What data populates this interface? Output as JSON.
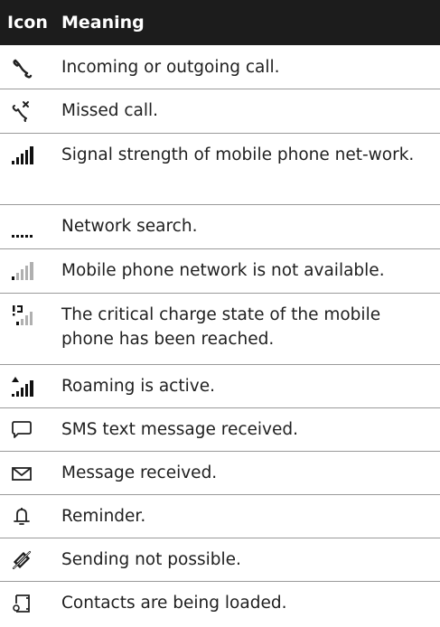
{
  "header": {
    "icon_label": "Icon",
    "meaning_label": "Meaning"
  },
  "rows": [
    {
      "icon": "phone-call-icon",
      "text": "Incoming or outgoing call."
    },
    {
      "icon": "missed-call-icon",
      "text": "Missed call."
    },
    {
      "icon": "signal-strength-icon",
      "text": "Signal strength of mobile phone net-work."
    },
    {
      "icon": "network-search-icon",
      "text": "Network search."
    },
    {
      "icon": "network-unavailable-icon",
      "text": "Mobile phone network is not available."
    },
    {
      "icon": "low-battery-signal-icon",
      "text": "The critical charge state of the mobile phone has been reached."
    },
    {
      "icon": "roaming-icon",
      "text": "Roaming is active."
    },
    {
      "icon": "sms-icon",
      "text": "SMS text message received."
    },
    {
      "icon": "envelope-icon",
      "text": "Message received."
    },
    {
      "icon": "bell-icon",
      "text": "Reminder."
    },
    {
      "icon": "sending-not-possible-icon",
      "text": "Sending not possible."
    },
    {
      "icon": "contacts-loading-icon",
      "text": "Contacts are being loaded."
    }
  ],
  "colors": {
    "header_bg": "#1c1c1c",
    "header_text": "#ffffff",
    "row_divider": "#9a9a9a",
    "dim_bars": "#b0b0b0"
  }
}
